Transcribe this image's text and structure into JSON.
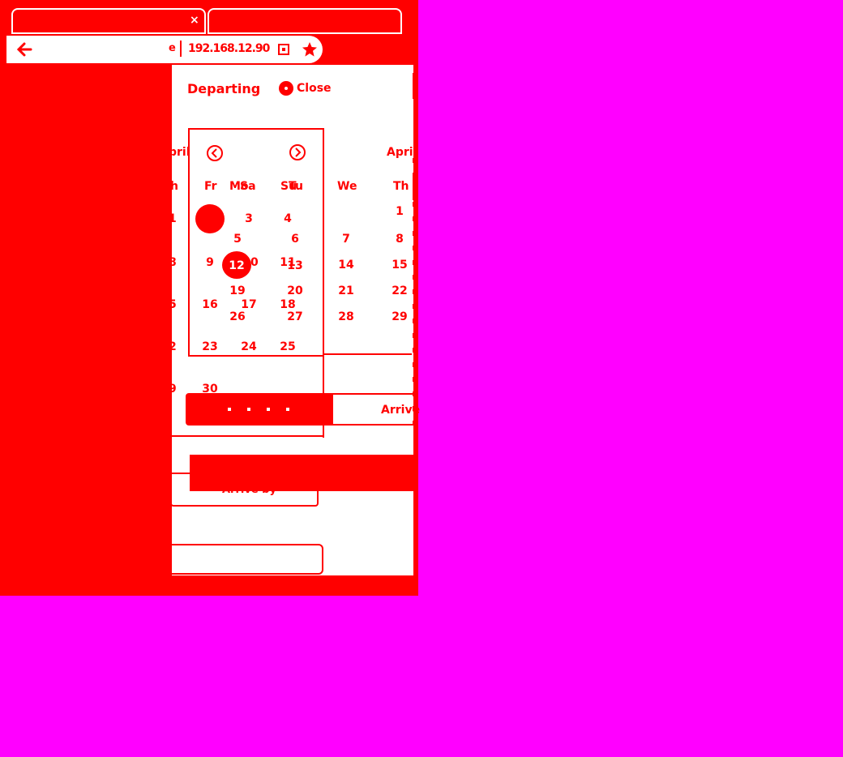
{
  "browser": {
    "tab_close_glyph": "×",
    "address": "192.168.12.90",
    "address_prefix": "e"
  },
  "header": {
    "departing_label": "Departing",
    "close_label": "Close"
  },
  "calendar_left": {
    "month_partial": "pril",
    "dow_partial": "h",
    "days_partial": [
      "1",
      "8",
      "5",
      "2",
      "9"
    ]
  },
  "calendar_mid": {
    "dow": [
      "Fr",
      "Mo",
      "Sa",
      "Su",
      "Tu"
    ],
    "days": [
      "3",
      "4",
      "5",
      "6",
      "9",
      "10",
      "11",
      "12",
      "13",
      "16",
      "17",
      "18",
      "19",
      "20",
      "26",
      "27",
      "23",
      "24",
      "25",
      "30"
    ]
  },
  "calendar_right": {
    "month": "April",
    "dow": [
      "We",
      "Th"
    ],
    "days": [
      "1",
      "7",
      "8",
      "14",
      "15",
      "21",
      "22",
      "28",
      "29"
    ]
  },
  "buttons": {
    "arrive_label": "Arrive",
    "arrive_by_label": "Arrive by"
  },
  "colors": {
    "background": "#ff00ff",
    "accent": "#ff0000",
    "surface": "#ffffff"
  }
}
